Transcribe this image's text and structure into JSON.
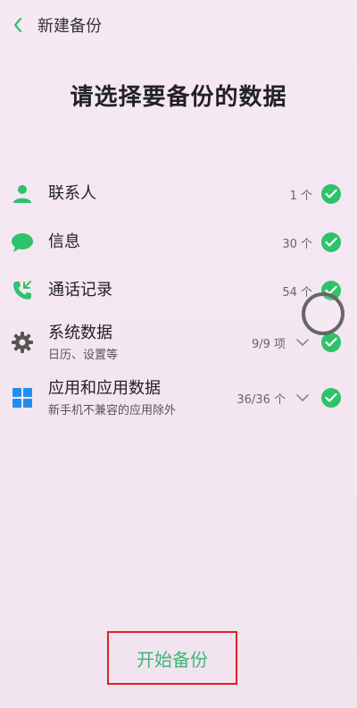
{
  "topbar": {
    "title": "新建备份"
  },
  "headline": "请选择要备份的数据",
  "items": [
    {
      "label": "联系人",
      "count": "1 个",
      "icon": "person-icon",
      "checked": true
    },
    {
      "label": "信息",
      "count": "30 个",
      "icon": "message-icon",
      "checked": true
    },
    {
      "label": "通话记录",
      "count": "54 个",
      "icon": "phone-icon",
      "checked": true
    },
    {
      "label": "系统数据",
      "sub": "日历、设置等",
      "count": "9/9 项",
      "icon": "gear-icon",
      "checked": true,
      "expandable": true
    },
    {
      "label": "应用和应用数据",
      "sub": "新手机不兼容的应用除外",
      "count": "36/36 个",
      "icon": "apps-grid-icon",
      "checked": true,
      "expandable": true
    }
  ],
  "start_button": {
    "label": "开始备份"
  },
  "colors": {
    "accent_green": "#2ec26b",
    "button_text": "#3ab77a",
    "highlight_red": "#e02020",
    "background": "#f4e6f1"
  }
}
